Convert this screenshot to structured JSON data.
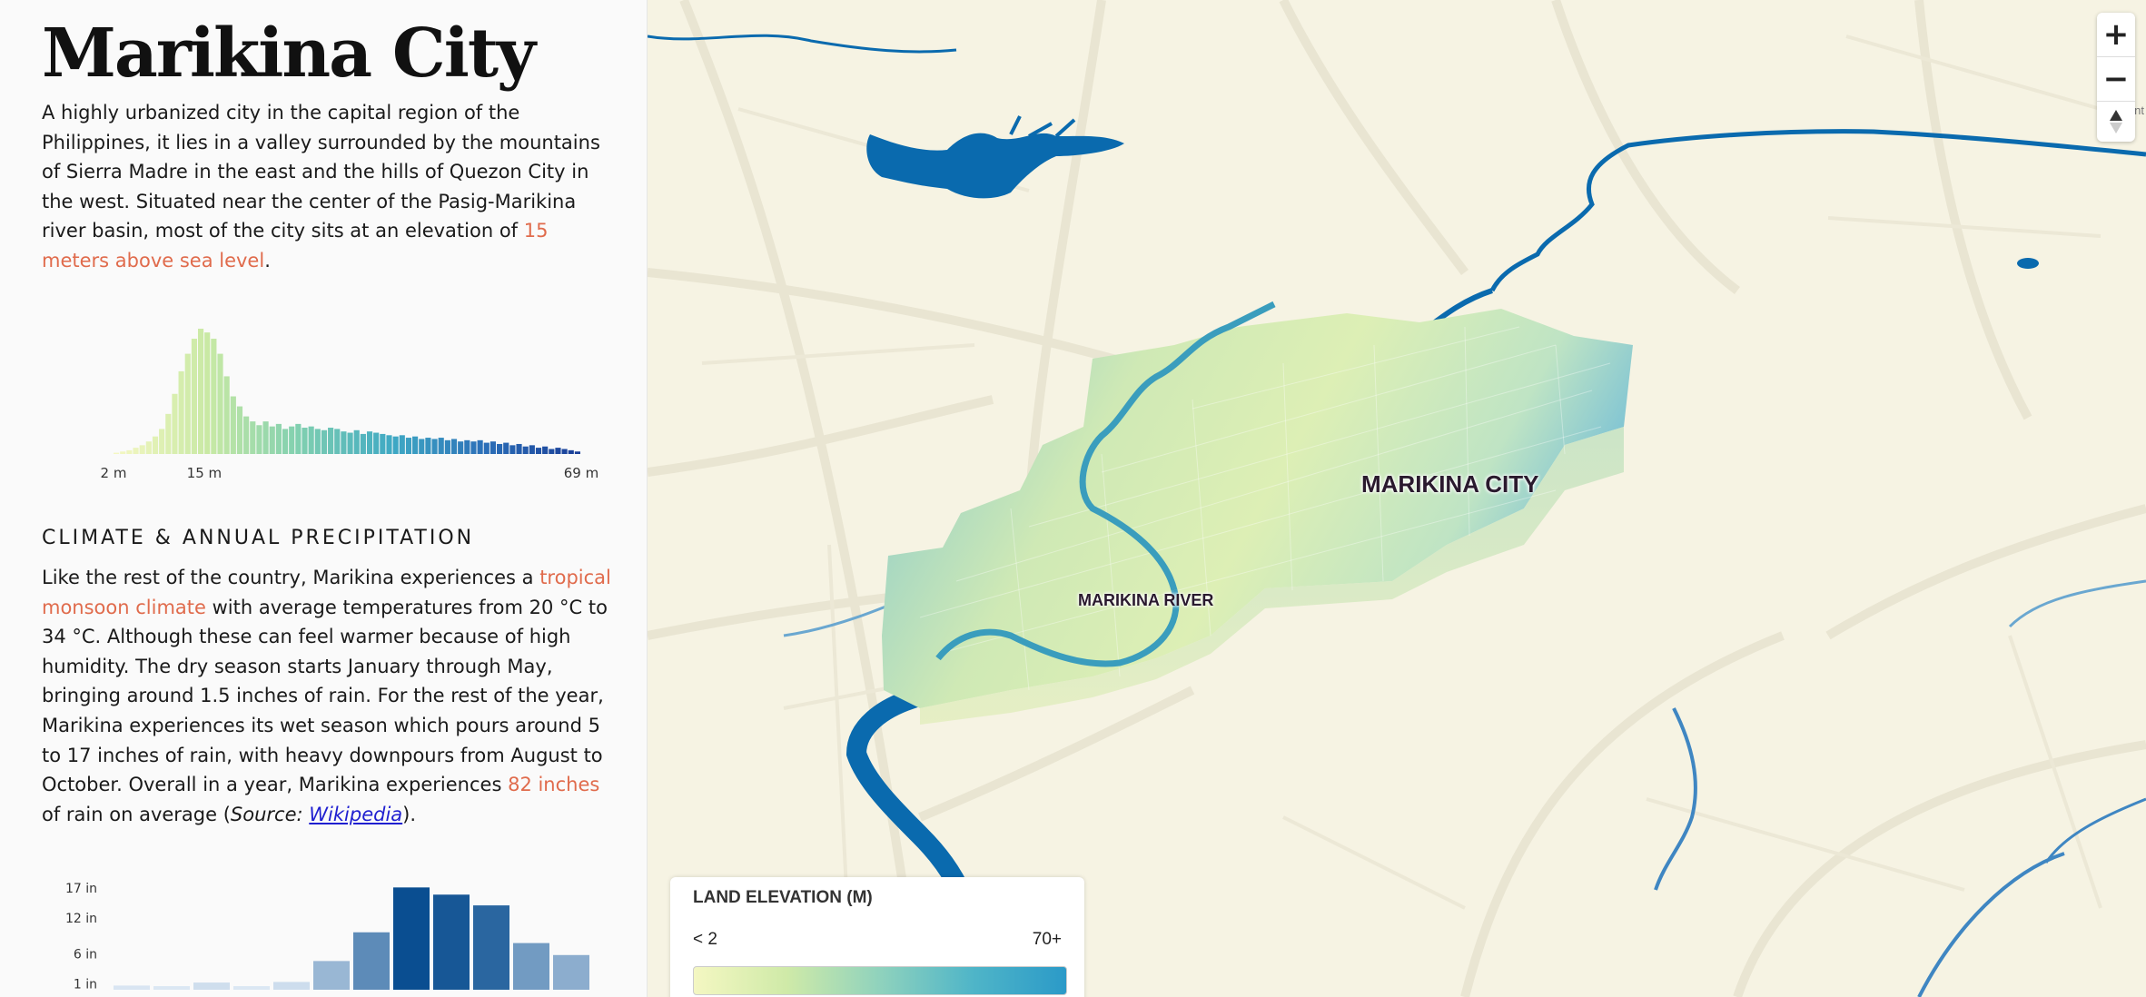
{
  "sidebar": {
    "title": "Marikina City",
    "intro": {
      "text_before": "A highly urbanized city in the capital region of the Philippines, it lies in a valley surrounded by the mountains of Sierra Madre in the east and the hills of Quezon City in the west. Situated near the center of the Pasig-Marikina river basin, most of the city sits at an elevation of ",
      "highlight": "15 meters above sea level",
      "text_after": "."
    },
    "climate": {
      "heading": "CLIMATE & ANNUAL PRECIPITATION",
      "text_1": "Like the rest of the country, Marikina experiences a ",
      "highlight_1": "tropical monsoon climate",
      "text_2": " with average temperatures from 20 °C to 34 °C. Although these can feel warmer because of high humidity. The dry season starts January through May, bringing around 1.5 inches of rain. For the rest of the year, Marikina experiences its wet season which pours around 5 to 17 inches of rain, with heavy downpours from August to October. Overall in a year, Marikina experiences ",
      "highlight_2": "82 inches",
      "text_3": " of rain on average (",
      "source_label": "Source:",
      "source_link": "Wikipedia",
      "text_4": ")."
    }
  },
  "chart_data": [
    {
      "type": "bar",
      "title": "",
      "xlabel": "",
      "ylabel": "",
      "tick_labels": [
        "2 m",
        "15 m",
        "69 m"
      ],
      "x_range": [
        2,
        69
      ],
      "values": [
        1,
        2,
        3,
        5,
        7,
        10,
        14,
        20,
        32,
        48,
        66,
        80,
        92,
        100,
        97,
        92,
        80,
        62,
        46,
        38,
        30,
        26,
        23,
        26,
        22,
        24,
        20,
        22,
        24,
        21,
        22,
        20,
        19,
        21,
        20,
        18,
        17,
        19,
        16,
        18,
        17,
        16,
        15,
        14,
        15,
        13,
        14,
        12,
        13,
        12,
        13,
        11,
        12,
        10,
        11,
        10,
        11,
        9,
        10,
        8,
        9,
        7,
        8,
        6,
        7,
        5,
        6,
        4,
        5,
        4,
        3,
        2
      ]
    },
    {
      "type": "bar",
      "title": "",
      "xlabel": "",
      "ylabel": "",
      "ytick_labels": [
        "17 in",
        "12 in",
        "6 in",
        "1 in"
      ],
      "yticks": [
        17,
        12,
        6,
        1
      ],
      "ylim": [
        0,
        17
      ],
      "values": [
        0.7,
        0.6,
        1.2,
        0.6,
        1.3,
        4.8,
        9.6,
        17.1,
        15.9,
        14.1,
        7.8,
        5.8
      ]
    }
  ],
  "map": {
    "city_label": "MARIKINA CITY",
    "river_label": "MARIKINA RIVER",
    "corner_label": "Mount",
    "zoom_in": "+",
    "zoom_out": "−",
    "legend": {
      "title": "LAND ELEVATION (M)",
      "min_label": "< 2",
      "max_label": "70+"
    }
  },
  "colors": {
    "highlight": "#e06b4c",
    "water": "#0a6aae",
    "land": "#f6f3e3",
    "elev_low": "#f4f7c2",
    "elev_high": "#2b9ac8",
    "precip_dark": "#0b4f91",
    "precip_light": "#eaf2fa"
  },
  "icons": {
    "compass": "compass-icon",
    "zoom_in": "plus-icon",
    "zoom_out": "minus-icon"
  }
}
